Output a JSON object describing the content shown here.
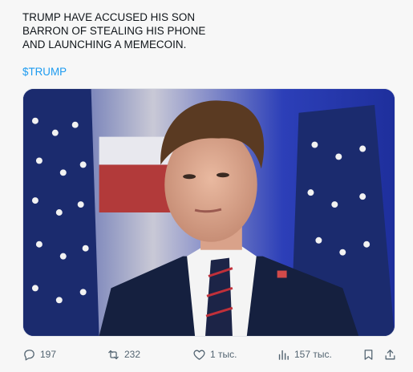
{
  "tweet": {
    "lines": [
      "TRUMP HAVE ACCUSED HIS SON",
      "BARRON OF STEALING HIS PHONE",
      "AND LAUNCHING A MEMECOIN."
    ],
    "cashtag": "$TRUMP"
  },
  "media": {
    "description_icon": "photo"
  },
  "actions": {
    "replies": "197",
    "reposts": "232",
    "likes": "1 тыс.",
    "views": "157 тыс."
  },
  "colors": {
    "link": "#1d9bf0",
    "icon": "#536471",
    "text": "#0f1419",
    "background": "#f7f7f7"
  }
}
